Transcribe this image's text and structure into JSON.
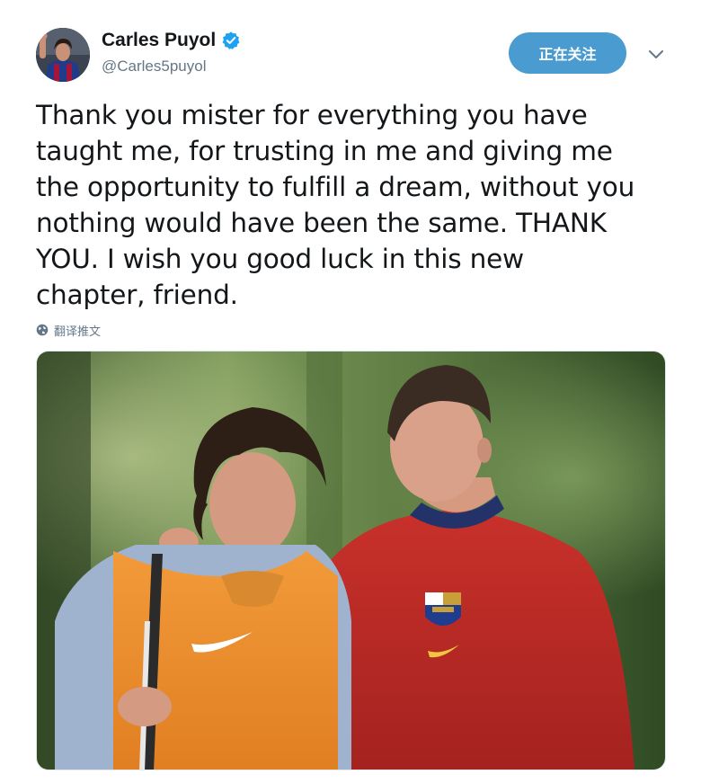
{
  "user": {
    "display_name": "Carles Puyol",
    "handle": "@Carles5puyol",
    "verified": true
  },
  "follow_button": {
    "label": "正在关注"
  },
  "tweet": {
    "text_lines": [
      "Thank you mister for everything you have",
      "taught me, for trusting in me and giving me",
      "the opportunity to fulfill a dream, without you",
      "nothing would have been the same. THANK",
      "YOU. I wish you good luck in this new",
      "chapter, friend."
    ]
  },
  "translate": {
    "label": "翻译推文"
  },
  "colors": {
    "accent": "#4a9bd0",
    "secondary_text": "#657786",
    "primary_text": "#14171a",
    "verified": "#1da1f2"
  },
  "icons": {
    "verified": "verified-badge-icon",
    "caret": "chevron-down-icon",
    "translate": "globe-icon"
  }
}
